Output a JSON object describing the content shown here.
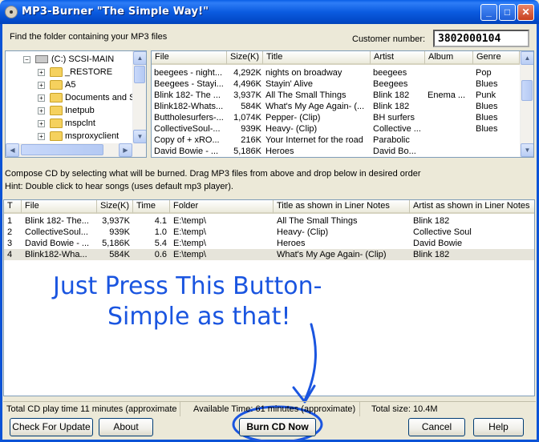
{
  "window": {
    "title": "MP3-Burner \"The Simple Way!\""
  },
  "header": {
    "find_label": "Find the folder containing your MP3 files",
    "customer_label": "Customer number:",
    "customer_number": "3802000104"
  },
  "tree": {
    "items": [
      {
        "label": "(C:) SCSI-MAIN",
        "sign": "−"
      },
      {
        "label": "_RESTORE",
        "sign": "+"
      },
      {
        "label": "A5",
        "sign": "+"
      },
      {
        "label": "Documents and S",
        "sign": "+"
      },
      {
        "label": "Inetpub",
        "sign": "+"
      },
      {
        "label": "mspclnt",
        "sign": "+"
      },
      {
        "label": "msproxyclient",
        "sign": "+"
      }
    ]
  },
  "files": {
    "columns": [
      "File",
      "Size(K)",
      "Title",
      "Artist",
      "Album",
      "Genre"
    ],
    "rows": [
      [
        "beegees - night...",
        "4,292K",
        "nights on broadway",
        "beegees",
        "",
        "Pop"
      ],
      [
        "Beegees - Stayi...",
        "4,496K",
        "Stayin' Alive",
        "Beegees",
        "",
        "Blues"
      ],
      [
        "Blink 182- The ...",
        "3,937K",
        "All The Small Things",
        "Blink 182",
        "Enema ...",
        "Punk"
      ],
      [
        "Blink182-Whats...",
        "584K",
        "What's My Age Again- (...",
        "Blink 182",
        "",
        "Blues"
      ],
      [
        "Buttholesurfers-...",
        "1,074K",
        "Pepper- (Clip)",
        "BH surfers",
        "",
        "Blues"
      ],
      [
        "CollectiveSoul-...",
        "939K",
        "Heavy- (Clip)",
        "Collective ...",
        "",
        "Blues"
      ],
      [
        "Copy of + xRO...",
        "216K",
        "Your Internet for the road",
        "Parabolic",
        "",
        ""
      ],
      [
        "David Bowie - ...",
        "5,186K",
        "Heroes",
        "David Bo...",
        "",
        ""
      ]
    ]
  },
  "compose": {
    "line1": "Compose CD by selecting what will be burned.  Drag MP3 files from above and drop below in desired order",
    "line2": "Hint: Double click to hear songs (uses default mp3 player)."
  },
  "burnlist": {
    "columns": [
      "T",
      "File",
      "Size(K)",
      "Time",
      "Folder",
      "Title as shown in Liner Notes",
      "Artist as shown in Liner Notes"
    ],
    "rows": [
      [
        "1",
        "Blink 182- The...",
        "3,937K",
        "4.1",
        "E:\\temp\\",
        "All The Small Things",
        "Blink 182"
      ],
      [
        "2",
        "CollectiveSoul...",
        "939K",
        "1.0",
        "E:\\temp\\",
        "Heavy- (Clip)",
        "Collective Soul"
      ],
      [
        "3",
        "David Bowie - ...",
        "5,186K",
        "5.4",
        "E:\\temp\\",
        "Heroes",
        "David Bowie"
      ],
      [
        "4",
        "Blink182-Wha...",
        "584K",
        "0.6",
        "E:\\temp\\",
        "What's My Age Again- (Clip)",
        "Blink 182"
      ]
    ]
  },
  "annotation": {
    "line1": "Just Press This Button-",
    "line2": "Simple as that!"
  },
  "status": {
    "total_play": "Total CD play time 11 minutes (approximate",
    "available": "Available Time: 61 minutes (approximate)",
    "total_size": "Total size: 10.4M"
  },
  "buttons": {
    "check_update": "Check For Update",
    "about": "About",
    "burn": "Burn CD Now",
    "cancel": "Cancel",
    "help": "Help"
  },
  "colors": {
    "annotation": "#1a55e0",
    "titlebar": "#0b5be0"
  }
}
